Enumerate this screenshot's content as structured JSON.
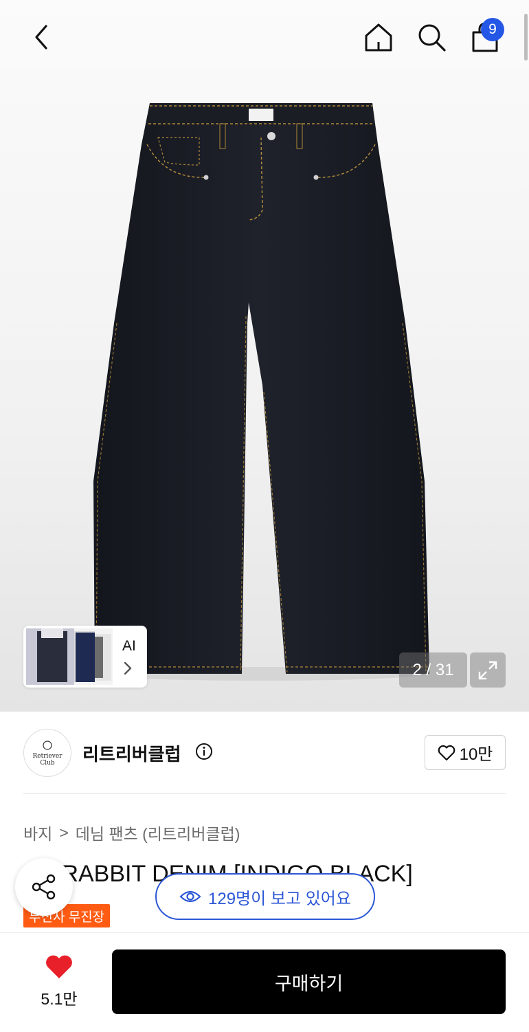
{
  "header": {
    "cart_count": "9",
    "icons": [
      "back-icon",
      "home-icon",
      "search-icon",
      "shopping-bag-icon"
    ]
  },
  "gallery": {
    "counter": "2 / 31",
    "ai_label": "AI",
    "product_logo_text": "Retriever Club"
  },
  "brand": {
    "name": "리트리버클럽",
    "logo_text": "Retriever Club",
    "likes": "10만"
  },
  "breadcrumb": {
    "category": "바지",
    "separator": ">",
    "subcategory": "데님 팬츠 (리트리버클럽)"
  },
  "product": {
    "title": "LIL RABBIT DENIM [INDIGO BLACK]",
    "badge": "무신사 무진장",
    "viewers": "129명이 보고 있어요"
  },
  "bottom": {
    "wish_count": "5.1만",
    "buy_label": "구매하기"
  },
  "colors": {
    "accent_blue": "#2c57d6",
    "badge_orange": "#ff5b13",
    "heart_red": "#e8202a"
  }
}
